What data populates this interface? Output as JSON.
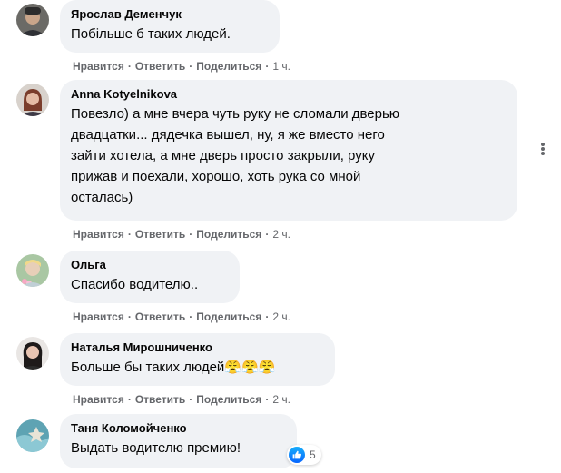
{
  "comments": [
    {
      "author": "Ярослав Деменчук",
      "text": "Побільше б таких людей.",
      "like_label": "Нравится",
      "reply_label": "Ответить",
      "share_label": "Поделиться",
      "time": "1 ч."
    },
    {
      "author": "Anna Kotyelnikova",
      "text": "Повезло) а мне вчера чуть руку не сломали дверью\nдвадцатки... дядечка вышел, ну, я же вместо него\nзайти хотела, а мне дверь просто закрыли, руку\nприжав и поехали, хорошо, хоть рука со мной\nосталась)",
      "like_label": "Нравится",
      "reply_label": "Ответить",
      "share_label": "Поделиться",
      "time": "2 ч."
    },
    {
      "author": "Ольга",
      "text": "Спасибо водителю..",
      "like_label": "Нравится",
      "reply_label": "Ответить",
      "share_label": "Поделиться",
      "time": "2 ч."
    },
    {
      "author": "Наталья Мирошниченко",
      "text": "Больше бы таких людей😤😤😤",
      "like_label": "Нравится",
      "reply_label": "Ответить",
      "share_label": "Поделиться",
      "time": "2 ч."
    },
    {
      "author": "Таня Коломойченко",
      "text": "Выдать водителю премию!",
      "reaction_icon": "like-icon",
      "reaction_count": "5"
    }
  ],
  "more_icon": "more-options-icon",
  "colors": {
    "bubble": "#f0f2f5",
    "meta": "#65676b",
    "like": "#0866ff"
  }
}
